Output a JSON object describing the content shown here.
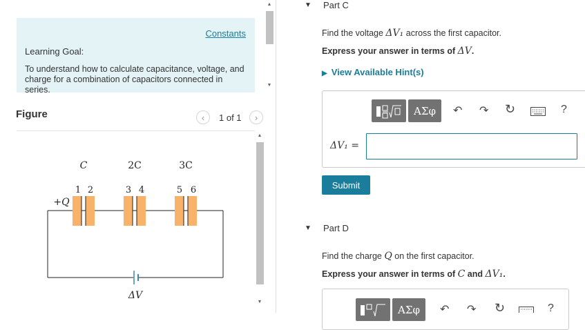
{
  "left_panel": {
    "constants_link": "Constants",
    "learning_goal_title": "Learning Goal:",
    "learning_goal_text": "To understand how to calculate capacitance, voltage, and charge for a combination of capacitors connected in series.",
    "figure_title": "Figure",
    "page_indicator": "1 of 1",
    "prev_icon": "chevron-left-icon",
    "next_icon": "chevron-right-icon"
  },
  "circuit": {
    "cap_labels": [
      "C",
      "2C",
      "3C"
    ],
    "plate_numbers": [
      "1",
      "2",
      "3",
      "4",
      "5",
      "6"
    ],
    "charge_label": "+Q",
    "voltage_label": "ΔV",
    "plate_color": "#f8b26a"
  },
  "part_c": {
    "title": "Part C",
    "question_pre": "Find the voltage ",
    "question_var": "ΔV₁",
    "question_post": " across the first capacitor.",
    "instruction_pre": "Express your answer in terms of ",
    "instruction_var": "ΔV",
    "instruction_post": ".",
    "hint_link": "View Available Hint(s)",
    "toolbar": {
      "template_icon": "fraction-sqrt-template-icon",
      "greek_label": "ΑΣφ",
      "undo_icon": "undo-icon",
      "redo_icon": "redo-icon",
      "reset_icon": "reset-icon",
      "keyboard_icon": "keyboard-icon",
      "help_label": "?"
    },
    "answer_label": "ΔV₁ =",
    "answer_value": "",
    "submit_label": "Submit"
  },
  "part_d": {
    "title": "Part D",
    "question_pre": "Find the charge ",
    "question_var": "Q",
    "question_post": " on the first capacitor.",
    "instruction_pre": "Express your answer in terms of ",
    "instruction_var1": "C",
    "instruction_mid": " and ",
    "instruction_var2": "ΔV₁",
    "instruction_post": ".",
    "toolbar": {
      "greek_label": "ΑΣφ",
      "help_label": "?"
    }
  },
  "colors": {
    "accent": "#1a7d9c",
    "goal_background": "#e4f3f6",
    "toolbar_button": "#727272"
  }
}
